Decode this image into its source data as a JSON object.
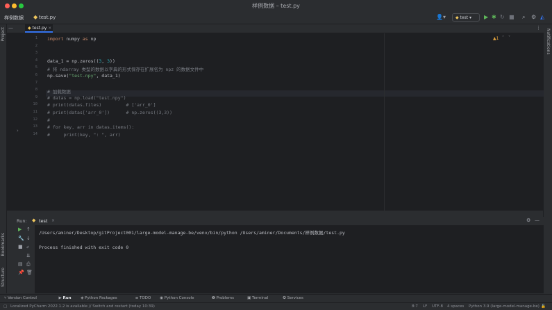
{
  "window": {
    "title": "样例数据 – test.py",
    "lights": {
      "close": "#ff5f57",
      "minimize": "#febc2e",
      "zoom": "#28c840"
    }
  },
  "toolbar": {
    "project": "样例数据",
    "file": "test.py",
    "run_config": "test"
  },
  "sidebar": {
    "project_label": "Project",
    "bookmarks_label": "Bookmarks",
    "structure_label": "Structure",
    "notifications_label": "Notifications"
  },
  "editor": {
    "tab_label": "test.py",
    "warnings": "▲1",
    "lines": [
      {
        "n": "1",
        "html": "<span class=\"kw\">import</span> numpy <span class=\"kw\">as</span> np"
      },
      {
        "n": "2",
        "html": ""
      },
      {
        "n": "3",
        "html": ""
      },
      {
        "n": "4",
        "html": "data_1 = np.zeros((<span class=\"num\">3</span>, <span class=\"num\">3</span>))"
      },
      {
        "n": "5",
        "html": "<span class=\"cmt\"># 将 ndarray 类型的数据以字典的形式保存在扩展名为 npz 的数据文件中</span>"
      },
      {
        "n": "6",
        "html": "np.save(<span class=\"str\">\"test.npy\"</span>, data_1)"
      },
      {
        "n": "7",
        "html": ""
      },
      {
        "n": "8",
        "html": "<span class=\"cmt\"># 加载数据</span>"
      },
      {
        "n": "9",
        "html": "<span class=\"cmt\"># datas = np.load(\"test.npy\")</span>"
      },
      {
        "n": "10",
        "html": "<span class=\"cmt\"># print(datas.files)         # ['arr_0']</span>"
      },
      {
        "n": "11",
        "html": "<span class=\"cmt\"># print(datas['arr_0'])      # np.zeros((3,3))</span>"
      },
      {
        "n": "12",
        "html": "<span class=\"cmt\">#</span>"
      },
      {
        "n": "13",
        "html": "<span class=\"cmt\"># for key, arr in datas.items():</span>"
      },
      {
        "n": "14",
        "html": "<span class=\"cmt\">#     print(key, \": \", arr)</span>"
      }
    ]
  },
  "run": {
    "label": "Run:",
    "tab": "test",
    "command": "/Users/aminer/Desktop/gitProject001/large-model-manage-be/venv/bin/python /Users/aminer/Documents/样例数据/test.py",
    "result": "Process finished with exit code 0"
  },
  "bottom_tools": [
    {
      "icon": "⑂",
      "label": "Version Control"
    },
    {
      "icon": "▶",
      "label": "Run"
    },
    {
      "icon": "◈",
      "label": "Python Packages"
    },
    {
      "icon": "≡",
      "label": "TODO"
    },
    {
      "icon": "◉",
      "label": "Python Console"
    },
    {
      "icon": "❶",
      "label": "Problems"
    },
    {
      "icon": "▣",
      "label": "Terminal"
    },
    {
      "icon": "✪",
      "label": "Services"
    }
  ],
  "status": {
    "message": "Localized PyCharm 2022.1.2 is available // Switch and restart (today 10:39)",
    "position": "8:7",
    "line_sep": "LF",
    "encoding": "UTF-8",
    "indent": "4 spaces",
    "interpreter": "Python 3.9 (large-model-manage-be)"
  }
}
